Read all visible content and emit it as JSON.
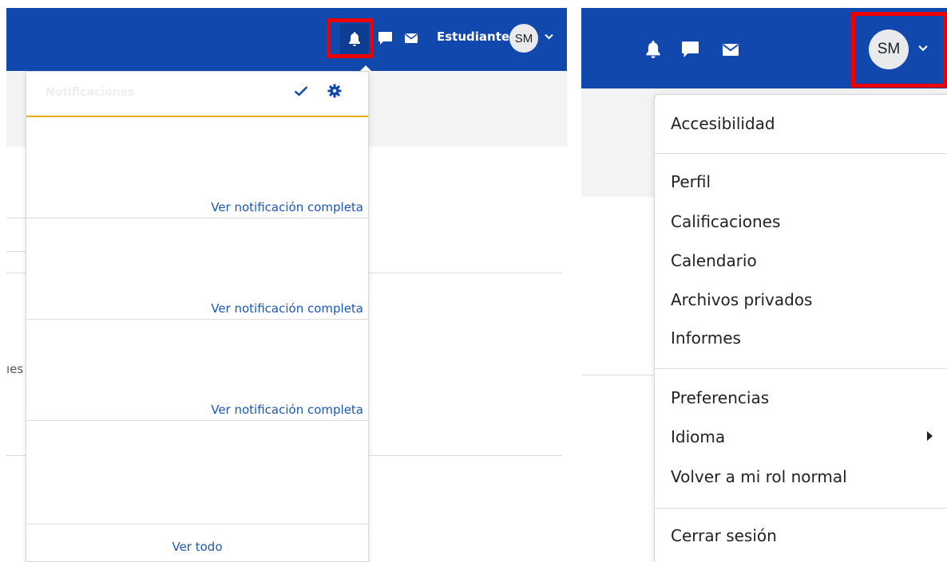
{
  "left_header": {
    "icons": [
      "bell-icon",
      "chat-icon",
      "envelope-icon"
    ],
    "user_name": "Estudiante",
    "avatar_initials": "SM",
    "dropdown_icon": "chevron-down-icon"
  },
  "background": {
    "cut_text": "ıes"
  },
  "notifications": {
    "title": "Notificaciones",
    "mark_read_icon": "check-icon",
    "settings_icon": "gear-icon",
    "items": [
      {
        "link": "Ver notificación completa"
      },
      {
        "link": "Ver notificación completa"
      },
      {
        "link": "Ver notificación completa"
      },
      {
        "link": ""
      }
    ],
    "see_all": "Ver todo"
  },
  "right_header": {
    "icons": [
      "bell-icon",
      "chat-icon",
      "envelope-icon"
    ],
    "avatar_initials": "SM",
    "dropdown_icon": "chevron-down-icon"
  },
  "user_menu": {
    "group1": [
      "Accesibilidad"
    ],
    "group2": [
      "Perfil",
      "Calificaciones",
      "Calendario",
      "Archivos privados",
      "Informes"
    ],
    "group3": [
      "Preferencias",
      "Idioma",
      "Volver a mi rol normal"
    ],
    "group4": [
      "Cerrar sesión"
    ]
  },
  "colors": {
    "navbar": "#1148ad",
    "highlight": "#ee0000",
    "link": "#1c57b4",
    "notification_underline": "#f0ad00"
  }
}
